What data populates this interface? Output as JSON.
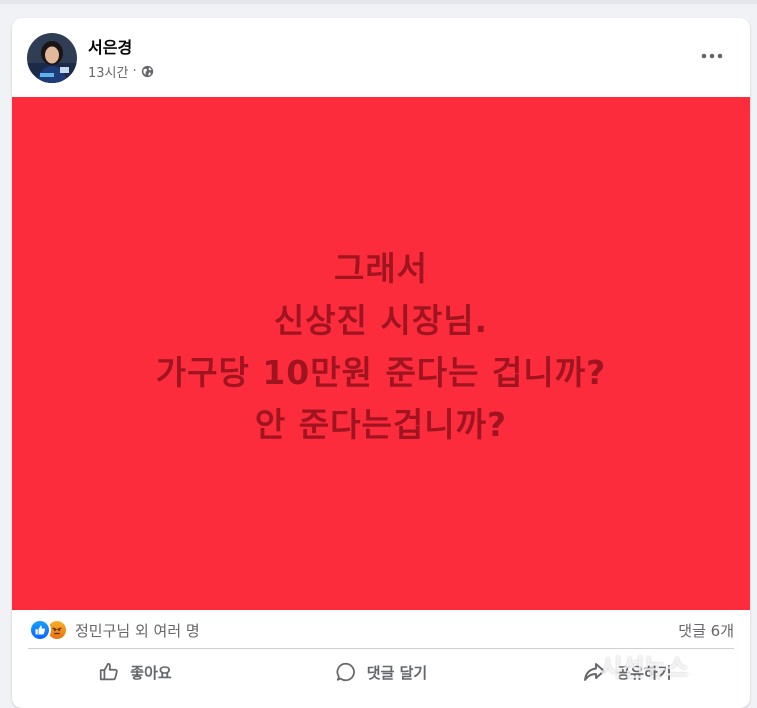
{
  "post": {
    "author": "서은경",
    "time": "13시간",
    "separator": "·",
    "image_text": {
      "line1": "그래서",
      "line2": "신상진 시장님.",
      "line3": "가구당 10만원 준다는 겁니까?",
      "line4": "안 준다는겁니까?"
    },
    "image_background": "#fc2c3d",
    "image_text_color": "#a0141f"
  },
  "stats": {
    "reactors": "정민구님 외 여러 명",
    "comments": "댓글 6개"
  },
  "actions": {
    "like": "좋아요",
    "comment": "댓글 달기",
    "share": "공유하기"
  },
  "icons": {
    "more": "more-icon",
    "globe": "globe-icon",
    "like_reaction": "like-reaction-icon",
    "angry_reaction": "angry-reaction-icon",
    "like": "thumbs-up-icon",
    "comment": "comment-icon",
    "share": "share-icon"
  },
  "watermark": "시선뉴스"
}
